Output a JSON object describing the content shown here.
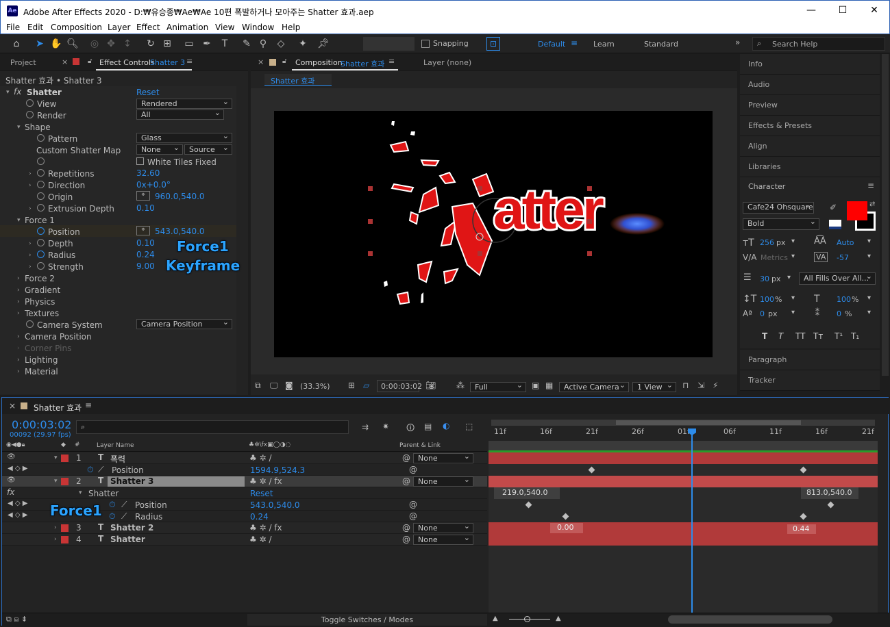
{
  "window": {
    "title": "Adobe After Effects 2020 - D:₩유승종₩Ae₩Ae 10편 폭발하거나 모아주는 Shatter 효과.aep",
    "icon": "Ae",
    "min": "—",
    "max": "☐",
    "close": "✕"
  },
  "menu": [
    "File",
    "Edit",
    "Composition",
    "Layer",
    "Effect",
    "Animation",
    "View",
    "Window",
    "Help"
  ],
  "toolbar": {
    "snapping": "Snapping",
    "workspaces": [
      "Default",
      "Learn",
      "Standard"
    ],
    "search_placeholder": "Search Help"
  },
  "project_tab": "Project",
  "effect_controls": {
    "tab": "Effect Controls",
    "tab_layer": "Shatter 3",
    "breadcrumb": "Shatter 효과 • Shatter 3",
    "effect_name": "Shatter",
    "reset": "Reset",
    "rows": {
      "view": "View",
      "view_val": "Rendered",
      "render": "Render",
      "render_val": "All",
      "shape": "Shape",
      "pattern": "Pattern",
      "pattern_val": "Glass",
      "custom_map": "Custom Shatter Map",
      "custom_map_val": "None",
      "custom_map_src": "Source",
      "white_tiles": "White Tiles Fixed",
      "repetitions": "Repetitions",
      "repetitions_val": "32.60",
      "direction": "Direction",
      "direction_val": "0x+0.0°",
      "origin": "Origin",
      "origin_val": "960.0,540.0",
      "extrusion": "Extrusion Depth",
      "extrusion_val": "0.10",
      "force1": "Force 1",
      "position": "Position",
      "position_val": "543.0,540.0",
      "depth": "Depth",
      "depth_val": "0.10",
      "radius": "Radius",
      "radius_val": "0.24",
      "strength": "Strength",
      "strength_val": "9.00",
      "force2": "Force 2",
      "gradient": "Gradient",
      "physics": "Physics",
      "textures": "Textures",
      "camera_system": "Camera System",
      "camera_system_val": "Camera Position",
      "camera_position": "Camera Position",
      "corner_pins": "Corner Pins",
      "lighting": "Lighting",
      "material": "Material"
    },
    "overlay": [
      "Force1",
      "Keyframe"
    ]
  },
  "composition": {
    "tab": "Composition",
    "tab_name": "Shatter 효과",
    "layer_tab": "Layer (none)",
    "crumb": "Shatter 효과",
    "canvas_text": "atter",
    "footer": {
      "zoom": "(33.3%)",
      "time": "0:00:03:02",
      "quality": "Full",
      "camera": "Active Camera",
      "views": "1 View"
    }
  },
  "right_panels": {
    "info": "Info",
    "audio": "Audio",
    "preview": "Preview",
    "effects_presets": "Effects & Presets",
    "align": "Align",
    "libraries": "Libraries",
    "character": "Character",
    "paragraph": "Paragraph",
    "tracker": "Tracker"
  },
  "character": {
    "font": "Cafe24 Ohsquare",
    "style": "Bold",
    "size": "256",
    "size_unit": "px",
    "leading": "Auto",
    "kerning": "Metrics",
    "tracking": "-57",
    "stroke": "30",
    "stroke_unit": "px",
    "stroke_mode": "All Fills Over All...",
    "vscale": "100",
    "vscale_unit": "%",
    "hscale": "100",
    "hscale_unit": "%",
    "baseline": "0",
    "baseline_unit": "px",
    "tsume": "0",
    "tsume_unit": "%",
    "fill_color": "#ff0000",
    "styles": [
      "T",
      "T",
      "TT",
      "Tт",
      "T¹",
      "T₁"
    ]
  },
  "timeline": {
    "tab": "Shatter 효과",
    "timecode": "0:00:03:02",
    "frames": "00092 (29.97 fps)",
    "search_placeholder": "",
    "col_layer": "Layer Name",
    "col_parent": "Parent & Link",
    "ruler": [
      "11f",
      "16f",
      "21f",
      "26f",
      "01f",
      "06f",
      "11f",
      "16f",
      "21f"
    ],
    "layers": [
      {
        "num": "1",
        "name": "폭력",
        "parent": "None"
      },
      {
        "prop": "Position",
        "val": "1594.9,524.3"
      },
      {
        "num": "2",
        "name": "Shatter 3",
        "parent": "None"
      },
      {
        "prop": "Shatter",
        "val": "Reset"
      },
      {
        "prop": "Position",
        "val": "543.0,540.0"
      },
      {
        "prop": "Radius",
        "val": "0.24"
      },
      {
        "num": "3",
        "name": "Shatter 2",
        "parent": "None"
      },
      {
        "num": "4",
        "name": "Shatter",
        "parent": "None"
      }
    ],
    "track_labels": {
      "pos_a": "219.0,540.0",
      "pos_b": "813.0,540.0",
      "rad_a": "0.00",
      "rad_b": "0.44"
    },
    "overlay": "Force1",
    "footer": "Toggle Switches / Modes"
  }
}
